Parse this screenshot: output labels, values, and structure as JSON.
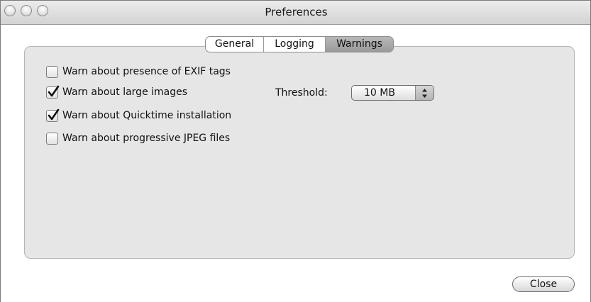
{
  "window": {
    "title": "Preferences"
  },
  "tabs": [
    {
      "label": "General",
      "selected": false
    },
    {
      "label": "Logging",
      "selected": false
    },
    {
      "label": "Warnings",
      "selected": true
    }
  ],
  "warnings": [
    {
      "label": "Warn about presence of EXIF tags",
      "checked": false
    },
    {
      "label": "Warn about large images",
      "checked": true
    },
    {
      "label": "Warn about Quicktime installation",
      "checked": true
    },
    {
      "label": "Warn about progressive JPEG files",
      "checked": false
    }
  ],
  "threshold": {
    "label": "Threshold:",
    "value": "10 MB"
  },
  "footer": {
    "close_label": "Close"
  }
}
